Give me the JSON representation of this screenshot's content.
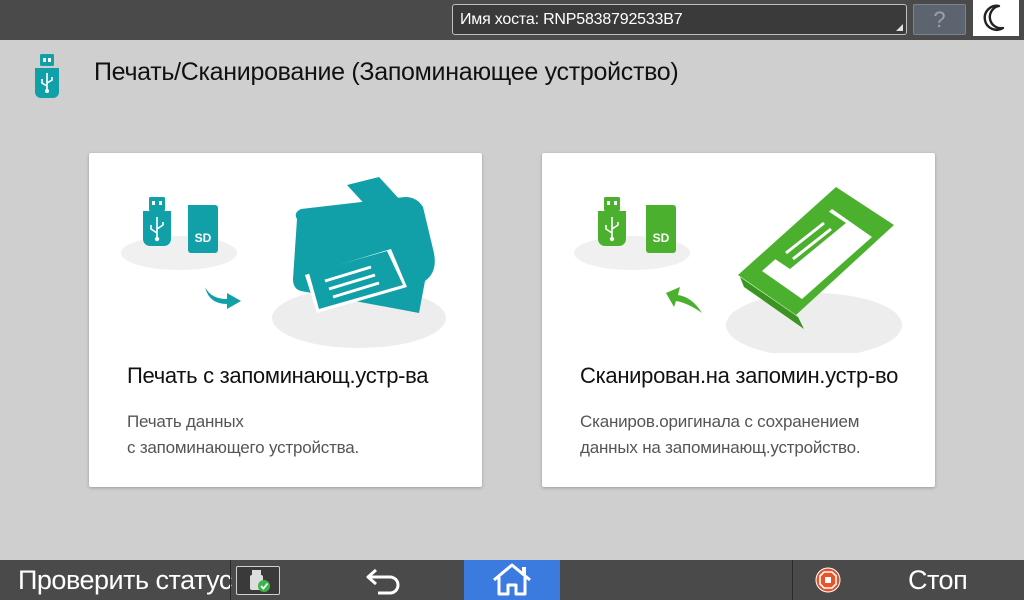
{
  "topbar": {
    "host_label": "Имя хоста: RNP5838792533B7",
    "help_symbol": "?"
  },
  "header": {
    "title": "Печать/Сканирование (Запоминающее устройство)",
    "icon": "usb-stick-icon"
  },
  "cards": {
    "print": {
      "title": "Печать с запоминающ.устр-ва",
      "desc_line1": "Печать данных",
      "desc_line2": "с запоминающего устройства.",
      "media_label": "SD",
      "accent": "#12a0a8"
    },
    "scan": {
      "title": "Сканирован.на запомин.устр-во",
      "desc_line1": "Сканиров.оригинала с сохранением",
      "desc_line2": "данных на запоминающ.устройство.",
      "media_label": "SD",
      "accent": "#4bb02d"
    }
  },
  "bottombar": {
    "status_label": "Проверить статус",
    "stop_label": "Стоп",
    "home_color": "#3b7be0"
  }
}
